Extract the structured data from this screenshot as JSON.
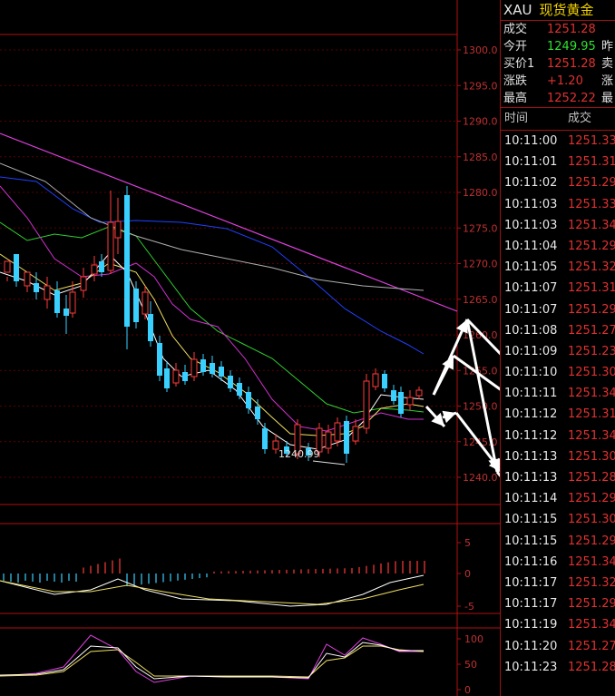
{
  "chart": {
    "price_ticks": [
      "1300.0",
      "1295.0",
      "1290.0",
      "1285.0",
      "1280.0",
      "1275.0",
      "1270.0",
      "1265.0",
      "1260.0",
      "1255.0",
      "1250.0",
      "1245.0",
      "1240.0"
    ],
    "low_label": "1240.99",
    "macd_ticks": [
      "5",
      "0",
      "-5"
    ],
    "kdj_ticks": [
      "100",
      "50",
      "0"
    ],
    "colors": {
      "up": "#ff3b3b",
      "down": "#39d0ff",
      "grid": "#5a0000",
      "axis": "#b01010",
      "ma5": "#ffffff",
      "ma10": "#f0e060",
      "ma20": "#d030d0",
      "ma30": "#30d030",
      "ma60": "#2040ff",
      "ma120": "#b0b0b0",
      "trend": "#e040e0"
    }
  },
  "quote": {
    "symbol": "XAU",
    "name": "现货黄金",
    "rows": [
      {
        "label": "成交",
        "value": "1251.28",
        "color": "#e03030",
        "label2": ""
      },
      {
        "label": "今开",
        "value": "1249.95",
        "color": "#30e030",
        "label2": "昨"
      },
      {
        "label": "买价1",
        "value": "1251.28",
        "color": "#e03030",
        "label2": "卖"
      },
      {
        "label": "涨跌",
        "value": "+1.20",
        "color": "#e03030",
        "label2": "涨"
      },
      {
        "label": "最高",
        "value": "1252.22",
        "color": "#e03030",
        "label2": "最"
      }
    ]
  },
  "trades": {
    "header_time": "时间",
    "header_price": "成交",
    "rows": [
      {
        "time": "10:11:00",
        "price": "1251.33"
      },
      {
        "time": "10:11:01",
        "price": "1251.31"
      },
      {
        "time": "10:11:02",
        "price": "1251.29"
      },
      {
        "time": "10:11:03",
        "price": "1251.33"
      },
      {
        "time": "10:11:03",
        "price": "1251.34"
      },
      {
        "time": "10:11:04",
        "price": "1251.29"
      },
      {
        "time": "10:11:05",
        "price": "1251.32"
      },
      {
        "time": "10:11:07",
        "price": "1251.31"
      },
      {
        "time": "10:11:07",
        "price": "1251.29"
      },
      {
        "time": "10:11:08",
        "price": "1251.27"
      },
      {
        "time": "10:11:09",
        "price": "1251.23"
      },
      {
        "time": "10:11:10",
        "price": "1251.30"
      },
      {
        "time": "10:11:11",
        "price": "1251.34"
      },
      {
        "time": "10:11:12",
        "price": "1251.31"
      },
      {
        "time": "10:11:12",
        "price": "1251.34"
      },
      {
        "time": "10:11:13",
        "price": "1251.30"
      },
      {
        "time": "10:11:13",
        "price": "1251.28"
      },
      {
        "time": "10:11:14",
        "price": "1251.29"
      },
      {
        "time": "10:11:15",
        "price": "1251.30"
      },
      {
        "time": "10:11:15",
        "price": "1251.29"
      },
      {
        "time": "10:11:16",
        "price": "1251.34"
      },
      {
        "time": "10:11:17",
        "price": "1251.32"
      },
      {
        "time": "10:11:17",
        "price": "1251.29"
      },
      {
        "time": "10:11:19",
        "price": "1251.34"
      },
      {
        "time": "10:11:20",
        "price": "1251.27"
      },
      {
        "time": "10:11:23",
        "price": "1251.28"
      }
    ]
  }
}
